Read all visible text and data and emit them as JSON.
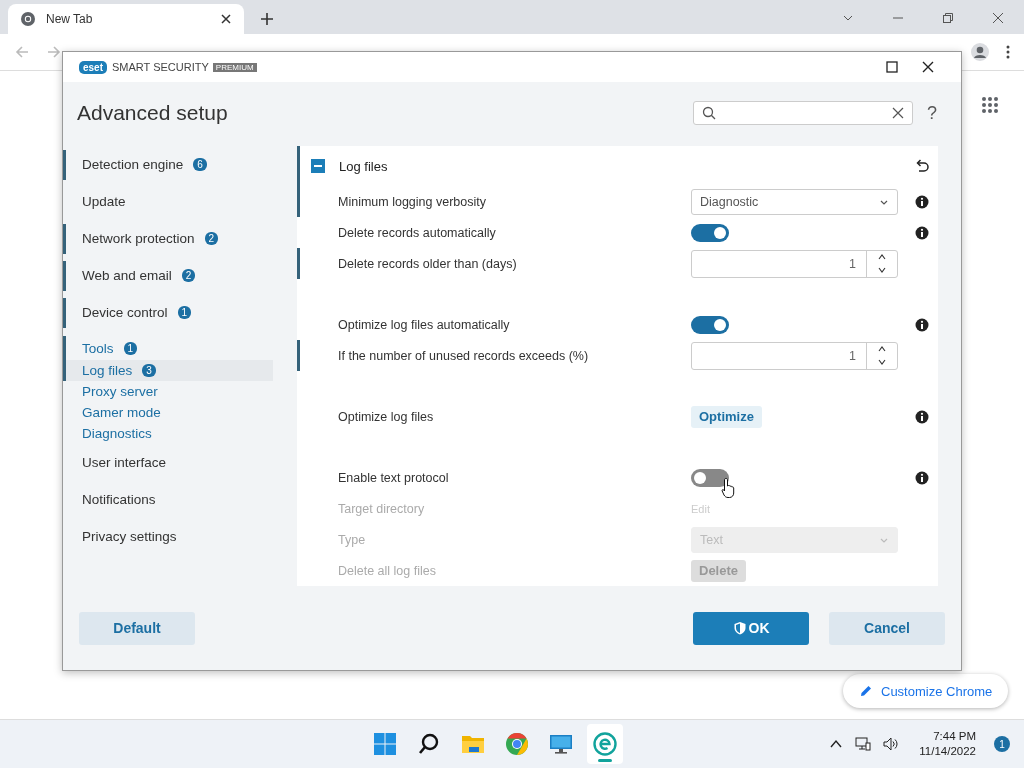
{
  "browser": {
    "tab_title": "New Tab",
    "customize": "Customize Chrome"
  },
  "dialog": {
    "logo": "eset",
    "brand": "SMART SECURITY",
    "edition": "PREMIUM",
    "title": "Advanced setup",
    "help": "?"
  },
  "sidebar": {
    "items": [
      {
        "label": "Detection engine",
        "badge": "6",
        "modified": true,
        "selected": false,
        "expanded": false
      },
      {
        "label": "Update",
        "modified": false,
        "selected": false,
        "expanded": false
      },
      {
        "label": "Network protection",
        "badge": "2",
        "modified": true,
        "selected": false,
        "expanded": false
      },
      {
        "label": "Web and email",
        "badge": "2",
        "modified": true,
        "selected": false,
        "expanded": false
      },
      {
        "label": "Device control",
        "badge": "1",
        "modified": true,
        "selected": false,
        "expanded": false
      },
      {
        "label": "Tools",
        "badge": "1",
        "modified": true,
        "selected": false,
        "expanded": true,
        "children": [
          {
            "label": "Log files",
            "badge": "3",
            "modified": true,
            "selected": true
          },
          {
            "label": "Proxy server",
            "modified": false,
            "selected": false
          },
          {
            "label": "Gamer mode",
            "modified": false,
            "selected": false
          },
          {
            "label": "Diagnostics",
            "modified": false,
            "selected": false
          }
        ]
      },
      {
        "label": "User interface",
        "modified": false,
        "selected": false,
        "expanded": false
      },
      {
        "label": "Notifications",
        "modified": false,
        "selected": false,
        "expanded": false
      },
      {
        "label": "Privacy settings",
        "modified": false,
        "selected": false,
        "expanded": false
      }
    ]
  },
  "panel": {
    "title": "Log files",
    "expanded": true,
    "modified": true,
    "groups": [
      {
        "rows": [
          {
            "kind": "select",
            "label": "Minimum logging verbosity",
            "value": "Diagnostic",
            "modified": true,
            "disabled": false,
            "info": true
          },
          {
            "kind": "toggle",
            "label": "Delete records automatically",
            "on": true,
            "modified": false,
            "disabled": false,
            "info": true
          },
          {
            "kind": "spinner",
            "label": "Delete records older than (days)",
            "value": "1",
            "modified": true,
            "disabled": false,
            "info": false
          }
        ]
      },
      {
        "rows": [
          {
            "kind": "toggle",
            "label": "Optimize log files automatically",
            "on": true,
            "modified": false,
            "disabled": false,
            "info": true
          },
          {
            "kind": "spinner",
            "label": "If the number of unused records exceeds (%)",
            "value": "1",
            "modified": true,
            "disabled": false,
            "info": false
          }
        ]
      },
      {
        "rows": [
          {
            "kind": "button",
            "label": "Optimize log files",
            "value": "Optimize",
            "modified": false,
            "disabled": false,
            "info": true
          }
        ]
      },
      {
        "rows": [
          {
            "kind": "toggle",
            "label": "Enable text protocol",
            "on": false,
            "modified": false,
            "disabled": false,
            "info": true
          },
          {
            "kind": "link",
            "label": "Target directory",
            "value": "Edit",
            "modified": false,
            "disabled": true,
            "info": false
          },
          {
            "kind": "select",
            "label": "Type",
            "value": "Text",
            "modified": false,
            "disabled": true,
            "info": false
          },
          {
            "kind": "button",
            "label": "Delete all log files",
            "value": "Delete",
            "modified": false,
            "disabled": true,
            "info": false
          }
        ]
      }
    ]
  },
  "footer": {
    "buttons": [
      {
        "label": "Default",
        "kind": "secondary"
      },
      {
        "label": "OK",
        "kind": "primary"
      },
      {
        "label": "Cancel",
        "kind": "secondary"
      }
    ]
  },
  "taskbar": {
    "apps": [
      {
        "kind": "start",
        "active": false
      },
      {
        "kind": "search",
        "active": false
      },
      {
        "kind": "folder",
        "active": false
      },
      {
        "kind": "chrome",
        "active": false
      },
      {
        "kind": "monitor",
        "active": false
      },
      {
        "kind": "eset",
        "active": true
      }
    ],
    "time": "7:44 PM",
    "date": "11/14/2022",
    "notifications": "1"
  }
}
